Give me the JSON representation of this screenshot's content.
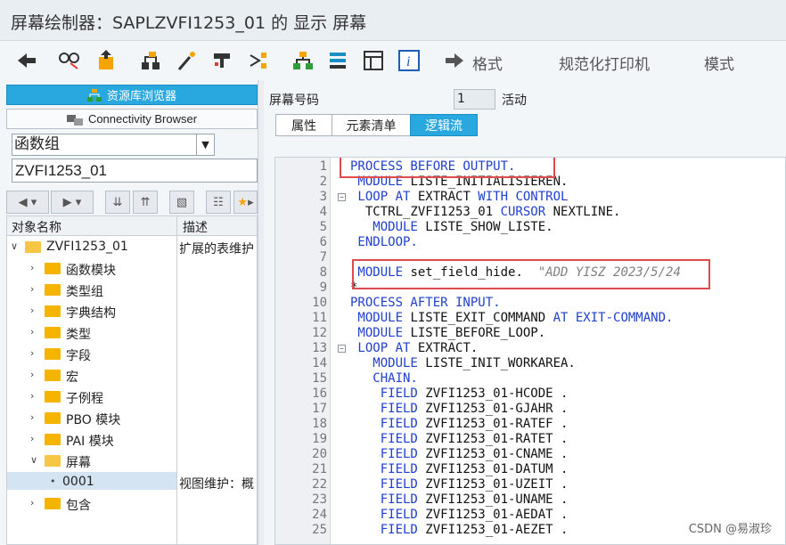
{
  "window": {
    "title": "屏幕绘制器：SAPLZVFI1253_01 的 显示 屏幕"
  },
  "toolbar": {
    "icons": [
      "back-arrow-icon",
      "glasses-icon",
      "transport-icon",
      "hierarchy-icon",
      "magic-wand-icon",
      "where-used-icon",
      "object-list-icon",
      "layout-icon",
      "element-list-icon",
      "table-icon",
      "info-icon"
    ],
    "format_label": "格式",
    "pretty_print_label": "规范化打印机",
    "mode_label": "模式"
  },
  "left": {
    "repo_browser_label": "资源库浏览器",
    "connectivity_label": "Connectivity Browser",
    "object_type_value": "函数组",
    "object_name_value": "ZVFI1253_01",
    "tree_header": {
      "col_name": "对象名称",
      "col_desc": "描述"
    },
    "tree": [
      {
        "label": "ZVFI1253_01",
        "desc": "扩展的表维护",
        "level": 0,
        "open": true
      },
      {
        "label": "函数模块",
        "desc": "",
        "level": 1,
        "open": false
      },
      {
        "label": "类型组",
        "desc": "",
        "level": 1,
        "open": false
      },
      {
        "label": "字典结构",
        "desc": "",
        "level": 1,
        "open": false
      },
      {
        "label": "类型",
        "desc": "",
        "level": 1,
        "open": false
      },
      {
        "label": "字段",
        "desc": "",
        "level": 1,
        "open": false
      },
      {
        "label": "宏",
        "desc": "",
        "level": 1,
        "open": false
      },
      {
        "label": "子例程",
        "desc": "",
        "level": 1,
        "open": false
      },
      {
        "label": "PBO 模块",
        "desc": "",
        "level": 1,
        "open": false
      },
      {
        "label": "PAI 模块",
        "desc": "",
        "level": 1,
        "open": false
      },
      {
        "label": "屏幕",
        "desc": "",
        "level": 1,
        "open": true
      },
      {
        "label": "0001",
        "desc": "视图维护：概",
        "level": 2,
        "selected": true
      },
      {
        "label": "包含",
        "desc": "",
        "level": 1,
        "open": false
      }
    ]
  },
  "right": {
    "screen_no_label": "屏幕号码",
    "screen_no_value": "1",
    "status_label": "活动",
    "tabs": [
      {
        "label": "属性",
        "active": false
      },
      {
        "label": "元素清单",
        "active": false
      },
      {
        "label": "逻辑流",
        "active": true
      }
    ],
    "code_lines": [
      {
        "n": "1",
        "code": [
          [
            "kw",
            "PROCESS BEFORE OUTPUT."
          ]
        ]
      },
      {
        "n": "2",
        "code": [
          [
            "kw",
            " MODULE"
          ],
          [
            "t",
            " LISTE_INITIALISIEREN."
          ]
        ]
      },
      {
        "n": "3",
        "code": [
          [
            "kw",
            " LOOP AT"
          ],
          [
            "t",
            " EXTRACT "
          ],
          [
            "kw",
            "WITH CONTROL"
          ]
        ]
      },
      {
        "n": "4",
        "code": [
          [
            "t",
            "  TCTRL_ZVFI1253_01 "
          ],
          [
            "kw",
            "CURSOR"
          ],
          [
            "t",
            " NEXTLINE."
          ]
        ]
      },
      {
        "n": "5",
        "code": [
          [
            "kw",
            "   MODULE"
          ],
          [
            "t",
            " LISTE_SHOW_LISTE."
          ]
        ]
      },
      {
        "n": "6",
        "code": [
          [
            "kw",
            " ENDLOOP."
          ]
        ]
      },
      {
        "n": "7",
        "code": [
          [
            "t",
            ""
          ]
        ]
      },
      {
        "n": "8",
        "code": [
          [
            "kw",
            " MODULE"
          ],
          [
            "t",
            " set_field_hide.  "
          ],
          [
            "cm",
            "\"ADD YISZ 2023/5/24"
          ]
        ]
      },
      {
        "n": "9",
        "code": [
          [
            "t",
            "*"
          ]
        ]
      },
      {
        "n": "10",
        "code": [
          [
            "kw",
            "PROCESS AFTER INPUT."
          ]
        ]
      },
      {
        "n": "11",
        "code": [
          [
            "kw",
            " MODULE"
          ],
          [
            "t",
            " LISTE_EXIT_COMMAND "
          ],
          [
            "kw",
            "AT EXIT-COMMAND."
          ]
        ]
      },
      {
        "n": "12",
        "code": [
          [
            "kw",
            " MODULE"
          ],
          [
            "t",
            " LISTE_BEFORE_LOOP."
          ]
        ]
      },
      {
        "n": "13",
        "code": [
          [
            "kw",
            " LOOP AT"
          ],
          [
            "t",
            " EXTRACT."
          ]
        ]
      },
      {
        "n": "14",
        "code": [
          [
            "kw",
            "   MODULE"
          ],
          [
            "t",
            " LISTE_INIT_WORKAREA."
          ]
        ]
      },
      {
        "n": "15",
        "code": [
          [
            "kw",
            "   CHAIN."
          ]
        ]
      },
      {
        "n": "16",
        "code": [
          [
            "kw",
            "    FIELD"
          ],
          [
            "t",
            " ZVFI1253_01-HCODE ."
          ]
        ]
      },
      {
        "n": "17",
        "code": [
          [
            "kw",
            "    FIELD"
          ],
          [
            "t",
            " ZVFI1253_01-GJAHR ."
          ]
        ]
      },
      {
        "n": "18",
        "code": [
          [
            "kw",
            "    FIELD"
          ],
          [
            "t",
            " ZVFI1253_01-RATEF ."
          ]
        ]
      },
      {
        "n": "19",
        "code": [
          [
            "kw",
            "    FIELD"
          ],
          [
            "t",
            " ZVFI1253_01-RATET ."
          ]
        ]
      },
      {
        "n": "20",
        "code": [
          [
            "kw",
            "    FIELD"
          ],
          [
            "t",
            " ZVFI1253_01-CNAME ."
          ]
        ]
      },
      {
        "n": "21",
        "code": [
          [
            "kw",
            "    FIELD"
          ],
          [
            "t",
            " ZVFI1253_01-DATUM ."
          ]
        ]
      },
      {
        "n": "22",
        "code": [
          [
            "kw",
            "    FIELD"
          ],
          [
            "t",
            " ZVFI1253_01-UZEIT ."
          ]
        ]
      },
      {
        "n": "23",
        "code": [
          [
            "kw",
            "    FIELD"
          ],
          [
            "t",
            " ZVFI1253_01-UNAME ."
          ]
        ]
      },
      {
        "n": "24",
        "code": [
          [
            "kw",
            "    FIELD"
          ],
          [
            "t",
            " ZVFI1253_01-AEDAT ."
          ]
        ]
      },
      {
        "n": "25",
        "code": [
          [
            "kw",
            "    FIELD"
          ],
          [
            "t",
            " ZVFI1253_01-AEZET ."
          ]
        ]
      }
    ]
  },
  "watermark": {
    "csdn": "CSDN @易淑珍"
  }
}
